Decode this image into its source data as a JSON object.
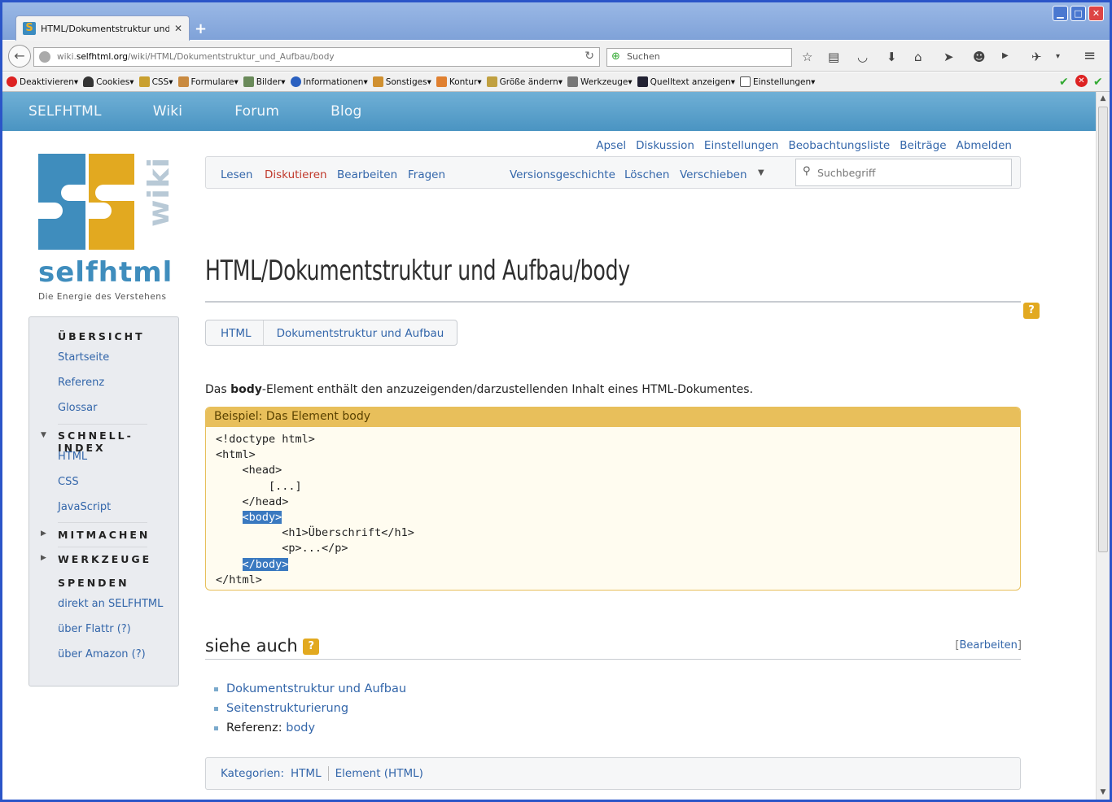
{
  "browser": {
    "tab_title": "HTML/Dokumentstruktur und ...",
    "url_prefix": "wiki.",
    "url_domain": "selfhtml.org",
    "url_path": "/wiki/HTML/Dokumentstruktur_und_Aufbau/body",
    "search_placeholder": "Suchen"
  },
  "bookmarks": [
    "Deaktivieren▾",
    "Cookies▾",
    "CSS▾",
    "Formulare▾",
    "Bilder▾",
    "Informationen▾",
    "Sonstiges▾",
    "Kontur▾",
    "Größe ändern▾",
    "Werkzeuge▾",
    "Quelltext anzeigen▾",
    "Einstellungen▾"
  ],
  "topnav": [
    "SELFHTML",
    "Wiki",
    "Forum",
    "Blog"
  ],
  "logo": {
    "word": "selfhtml",
    "tagline": "Die Energie des Verstehens",
    "side": "wiki"
  },
  "sidebar": {
    "overview": "ÜBERSICHT",
    "overview_links": [
      "Startseite",
      "Referenz",
      "Glossar"
    ],
    "quick": "SCHNELL-INDEX",
    "quick_links": [
      "HTML",
      "CSS",
      "JavaScript"
    ],
    "join": "MITMACHEN",
    "tools": "WERKZEUGE",
    "donate": "SPENDEN",
    "donate_links": [
      "direkt an SELFHTML",
      "über Flattr (?)",
      "über Amazon (?)"
    ]
  },
  "personal_tools": [
    "Apsel",
    "Diskussion",
    "Einstellungen",
    "Beobachtungsliste",
    "Beiträge",
    "Abmelden"
  ],
  "actions": {
    "read": "Lesen",
    "discuss": "Diskutieren",
    "edit": "Bearbeiten",
    "questions": "Fragen",
    "history": "Versionsgeschichte",
    "delete": "Löschen",
    "move": "Verschieben"
  },
  "wiki_search_placeholder": "Suchbegriff",
  "page_title": "HTML/Dokumentstruktur und Aufbau/body",
  "breadcrumb": [
    "HTML",
    "Dokumentstruktur und Aufbau"
  ],
  "intro": {
    "before": "Das ",
    "bold": "body",
    "after": "-Element enthält den anzuzeigenden/darzustellenden Inhalt eines HTML-Dokumentes."
  },
  "example": {
    "header": "Beispiel: Das Element body",
    "lines": [
      "<!doctype html>",
      "<html>",
      "    <head>",
      "        [...]",
      "    </head>",
      "    <body>",
      "          <h1>Überschrift</h1>",
      "          <p>...</p>",
      "    </body>",
      "</html>"
    ]
  },
  "see_also": {
    "heading": "siehe auch",
    "edit_label": "Bearbeiten",
    "items": [
      "Dokumentstruktur und Aufbau",
      "Seitenstrukturierung"
    ],
    "ref_label": "Referenz: ",
    "ref_link": "body"
  },
  "categories": {
    "label": "Kategorien:",
    "items": [
      "HTML",
      "Element (HTML)"
    ]
  },
  "colors": {
    "accent": "#3366aa",
    "brand_blue": "#4a94c2",
    "brand_gold": "#e2a920"
  }
}
